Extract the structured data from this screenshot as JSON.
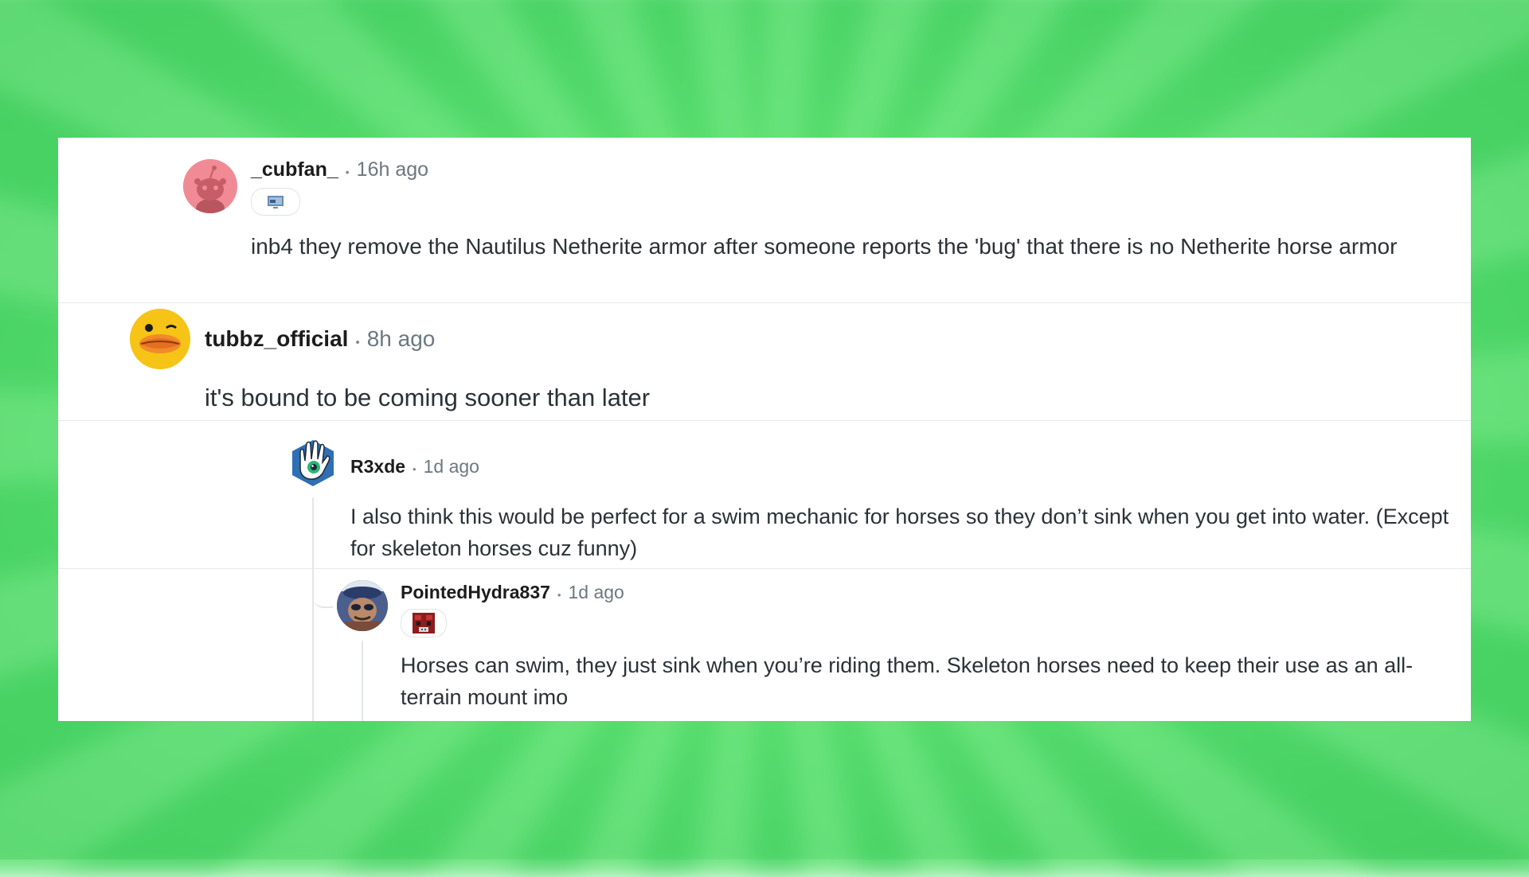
{
  "comments": [
    {
      "username": "_cubfan_",
      "separator": "•",
      "time": "16h ago",
      "flair_icon": "monitor-flair-icon",
      "avatar": "snoo-avatar-pink",
      "body": "inb4 they remove the Nautilus Netherite armor after someone reports the 'bug' that there is no Netherite horse armor"
    },
    {
      "username": "tubbz_official",
      "separator": "•",
      "time": "8h ago",
      "avatar": "duck-avatar",
      "body": "it's bound to be coming sooner than later"
    },
    {
      "username": "R3xde",
      "separator": "•",
      "time": "1d ago",
      "avatar": "hand-eye-avatar",
      "body": "I also think this would be perfect for a swim mechanic for horses so they don’t sink when you get into water. (Except for skeleton horses cuz funny)"
    },
    {
      "username": "PointedHydra837",
      "separator": "•",
      "time": "1d ago",
      "flair_icon": "minecraft-mooshroom-flair-icon",
      "avatar": "character-avatar",
      "body": "Horses can swim, they just sink when you’re riding them. Skeleton horses need to keep their use as an all-terrain mount imo"
    }
  ],
  "colors": {
    "background_green": "#5fdc75",
    "card": "#ffffff",
    "username": "#1c1c1c",
    "meta": "#6b7880",
    "body": "#2a3236",
    "divider": "#e6e8ea"
  }
}
